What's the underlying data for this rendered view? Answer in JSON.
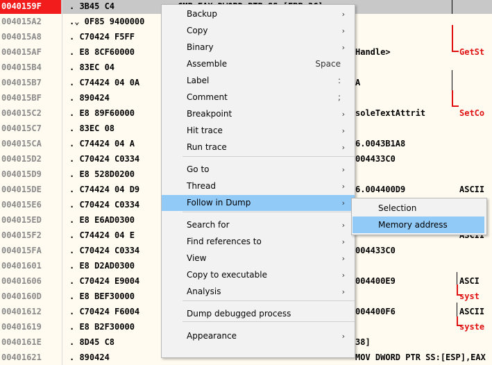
{
  "disasm": {
    "rows": [
      {
        "addr": "0040159F",
        "hex": ". 3B45 C4",
        "asm": "CMP EAX,DWORD PTR SS:[EBP-3C]",
        "cmt": "",
        "red": false
      },
      {
        "addr": "004015A2",
        "hex": ".⌄ 0F85 9400000",
        "asm": "",
        "cmt": "",
        "red": false
      },
      {
        "addr": "004015A8",
        "hex": ". C70424 F5FF",
        "asm": "",
        "cmt": "",
        "red": false
      },
      {
        "addr": "004015AF",
        "hex": ". E8 8CF60000",
        "asm": "Handle>",
        "cmt": "GetSt",
        "red": true
      },
      {
        "addr": "004015B4",
        "hex": ". 83EC 04",
        "asm": "",
        "cmt": "",
        "red": false
      },
      {
        "addr": "004015B7",
        "hex": ". C74424 04 0A",
        "asm": "A",
        "cmt": "",
        "red": false
      },
      {
        "addr": "004015BF",
        "hex": ". 890424",
        "asm": "",
        "cmt": "",
        "red": false
      },
      {
        "addr": "004015C2",
        "hex": ". E8 89F60000",
        "asm": "soleTextAttrit",
        "cmt": "SetCo",
        "red": true
      },
      {
        "addr": "004015C7",
        "hex": ". 83EC 08",
        "asm": "",
        "cmt": "",
        "red": false
      },
      {
        "addr": "004015CA",
        "hex": ". C74424 04 A",
        "asm": "6.0043B1A8",
        "cmt": "",
        "red": false
      },
      {
        "addr": "004015D2",
        "hex": ". C70424 C0334",
        "asm": "004433C0",
        "cmt": "",
        "red": false
      },
      {
        "addr": "004015D9",
        "hex": ". E8 528D0200",
        "asm": "",
        "cmt": "",
        "red": false
      },
      {
        "addr": "004015DE",
        "hex": ". C74424 04 D9",
        "asm": "6.004400D9",
        "cmt": "ASCII",
        "red": false
      },
      {
        "addr": "004015E6",
        "hex": ". C70424 C0334",
        "asm": "",
        "cmt": "",
        "red": false
      },
      {
        "addr": "004015ED",
        "hex": ". E8 E6AD0300",
        "asm": "",
        "cmt": "",
        "red": false
      },
      {
        "addr": "004015F2",
        "hex": ". C74424 04 E",
        "asm": "",
        "cmt": "ASCII",
        "red": false
      },
      {
        "addr": "004015FA",
        "hex": ". C70424 C0334",
        "asm": "004433C0",
        "cmt": "",
        "red": false
      },
      {
        "addr": "00401601",
        "hex": ". E8 D2AD0300",
        "asm": "",
        "cmt": "",
        "red": false
      },
      {
        "addr": "00401606",
        "hex": ". C70424 E9004",
        "asm": "004400E9",
        "cmt": "ASCI",
        "red": false
      },
      {
        "addr": "0040160D",
        "hex": ". E8 BEF30000",
        "asm": "",
        "cmt": "syst",
        "red": true
      },
      {
        "addr": "00401612",
        "hex": ". C70424 F6004",
        "asm": "004400F6",
        "cmt": "ASCII",
        "red": false
      },
      {
        "addr": "00401619",
        "hex": ". E8 B2F30000",
        "asm": "",
        "cmt": "syste",
        "red": true
      },
      {
        "addr": "0040161E",
        "hex": ". 8D45 C8",
        "asm": "38]",
        "cmt": "",
        "red": false
      },
      {
        "addr": "00401621",
        "hex": ". 890424",
        "asm": "MOV DWORD PTR SS:[ESP],EAX",
        "cmt": "",
        "red": false
      }
    ]
  },
  "menu": {
    "items": [
      {
        "label": "Backup",
        "arrow": "›",
        "shortcut": ""
      },
      {
        "label": "Copy",
        "arrow": "›",
        "shortcut": ""
      },
      {
        "label": "Binary",
        "arrow": "›",
        "shortcut": ""
      },
      {
        "label": "Assemble",
        "arrow": "",
        "shortcut": "Space"
      },
      {
        "label": "Label",
        "arrow": "",
        "shortcut": ":"
      },
      {
        "label": "Comment",
        "arrow": "",
        "shortcut": ";"
      },
      {
        "label": "Breakpoint",
        "arrow": "›",
        "shortcut": ""
      },
      {
        "label": "Hit trace",
        "arrow": "›",
        "shortcut": ""
      },
      {
        "label": "Run trace",
        "arrow": "›",
        "shortcut": ""
      },
      {
        "label": "Go to",
        "arrow": "›",
        "shortcut": ""
      },
      {
        "label": "Thread",
        "arrow": "›",
        "shortcut": ""
      },
      {
        "label": "Follow in Dump",
        "arrow": "›",
        "shortcut": ""
      },
      {
        "label": "Search for",
        "arrow": "›",
        "shortcut": ""
      },
      {
        "label": "Find references to",
        "arrow": "›",
        "shortcut": ""
      },
      {
        "label": "View",
        "arrow": "›",
        "shortcut": ""
      },
      {
        "label": "Copy to executable",
        "arrow": "›",
        "shortcut": ""
      },
      {
        "label": "Analysis",
        "arrow": "›",
        "shortcut": ""
      },
      {
        "label": "Dump debugged process",
        "arrow": "",
        "shortcut": ""
      },
      {
        "label": "Appearance",
        "arrow": "›",
        "shortcut": ""
      }
    ]
  },
  "submenu": {
    "items": [
      {
        "label": "Selection"
      },
      {
        "label": "Memory address"
      }
    ]
  },
  "colors": {
    "selected_address_bg": "#f21c1c",
    "menu_highlight": "#91c9f7",
    "call_comment_red": "#e01010",
    "background": "#fffbf0"
  }
}
